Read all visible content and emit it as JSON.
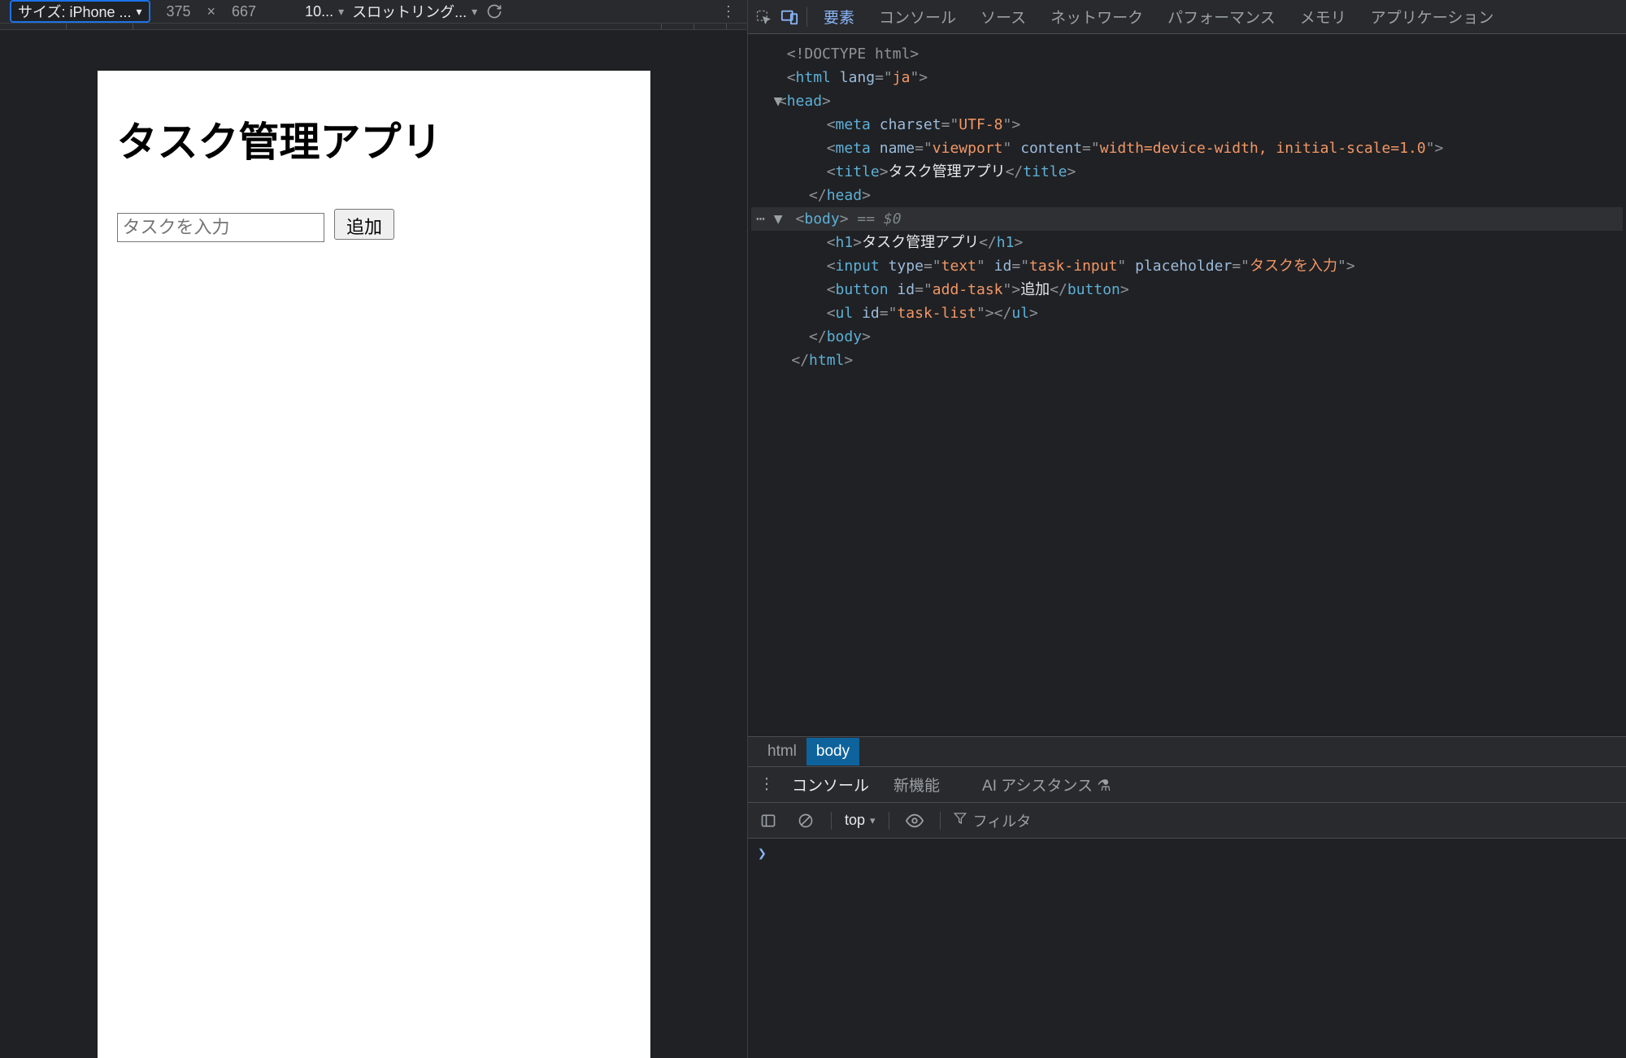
{
  "device_toolbar": {
    "device_label": "サイズ: iPhone ...",
    "width": "375",
    "x": "×",
    "height": "667",
    "zoom": "10...",
    "throttling": "スロットリング..."
  },
  "preview": {
    "title": "タスク管理アプリ",
    "input_placeholder": "タスクを入力",
    "add_button": "追加"
  },
  "tabs": {
    "elements": "要素",
    "console": "コンソール",
    "sources": "ソース",
    "network": "ネットワーク",
    "performance": "パフォーマンス",
    "memory": "メモリ",
    "application": "アプリケーション"
  },
  "elements_tree": {
    "doctype": "<!DOCTYPE html>",
    "html_open": "html",
    "lang_attr": "lang",
    "lang_val": "ja",
    "head": "head",
    "meta_charset_attr": "charset",
    "meta_charset_val": "UTF-8",
    "meta_name_attr": "name",
    "meta_name_val": "viewport",
    "meta_content_attr": "content",
    "meta_content_val": "width=device-width, initial-scale=1.0",
    "title_tag": "title",
    "title_text": "タスク管理アプリ",
    "body": "body",
    "eq_selected": " == $0",
    "h1": "h1",
    "h1_text": "タスク管理アプリ",
    "input": "input",
    "type_attr": "type",
    "type_val": "text",
    "id_attr": "id",
    "input_id_val": "task-input",
    "placeholder_attr": "placeholder",
    "placeholder_val": "タスクを入力",
    "button": "button",
    "button_id_val": "add-task",
    "button_text": "追加",
    "ul": "ul",
    "ul_id_val": "task-list",
    "meta": "meta"
  },
  "breadcrumbs": {
    "html": "html",
    "body": "body"
  },
  "drawer": {
    "console_tab": "コンソール",
    "whatsnew_tab": "新機能",
    "ai_assistance": "AI アシスタンス ⚗",
    "context": "top",
    "filter_placeholder": "フィルタ",
    "prompt": "❯"
  }
}
